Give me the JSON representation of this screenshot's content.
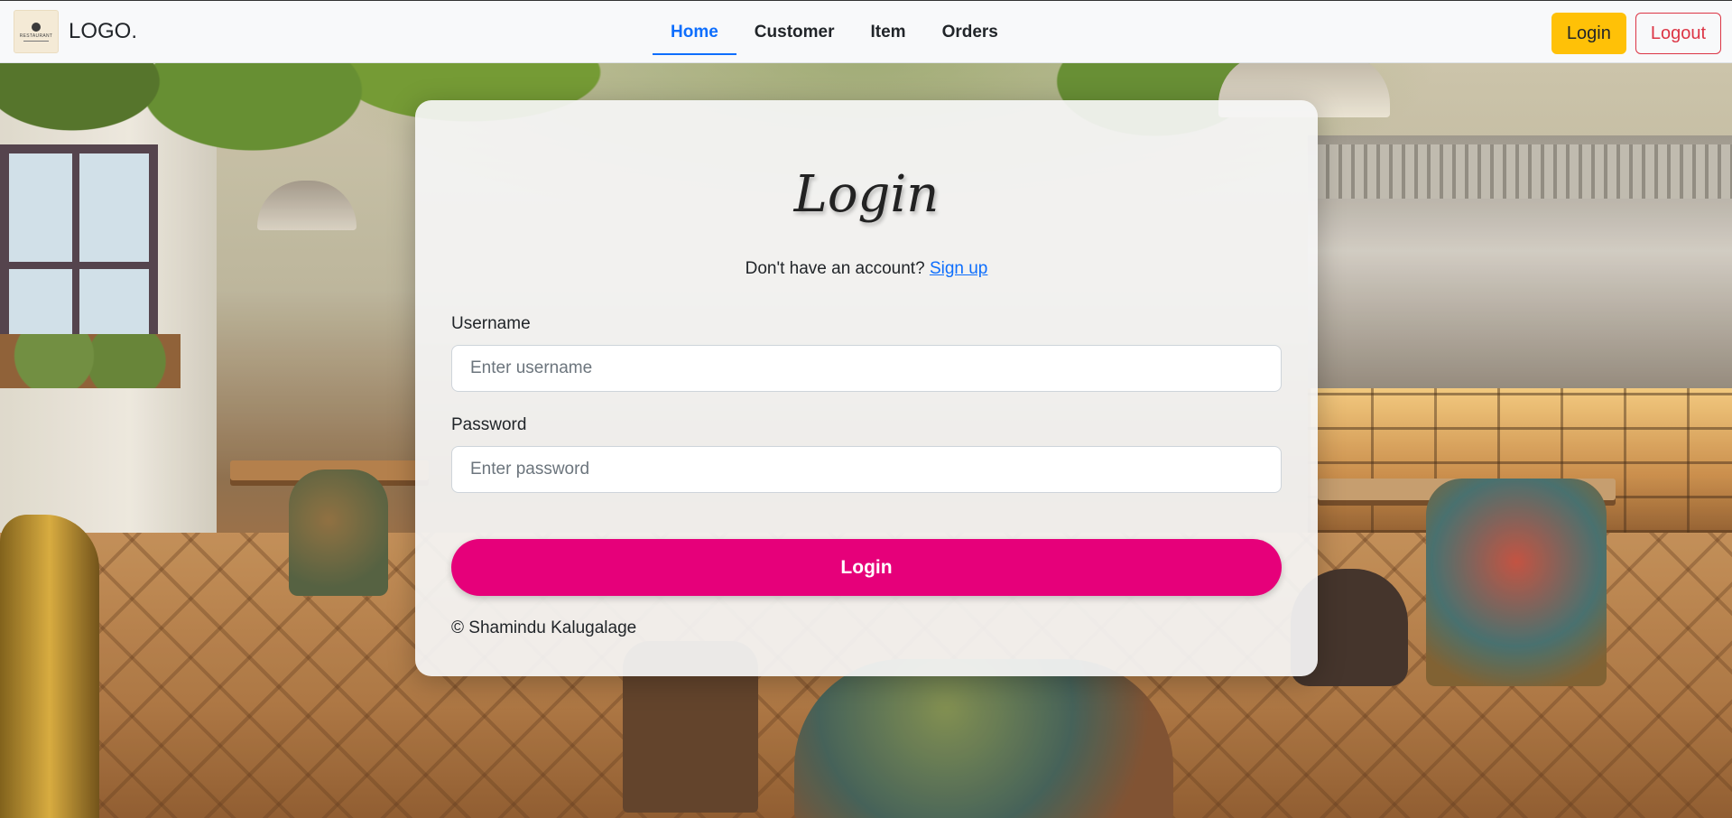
{
  "navbar": {
    "brand_logo_text": "RESTAURANT",
    "brand_name": "LOGO.",
    "links": [
      {
        "label": "Home",
        "active": true
      },
      {
        "label": "Customer",
        "active": false
      },
      {
        "label": "Item",
        "active": false
      },
      {
        "label": "Orders",
        "active": false
      }
    ],
    "login_label": "Login",
    "logout_label": "Logout"
  },
  "login_card": {
    "title": "Login",
    "signup_prompt": "Don't have an account?",
    "signup_link": "Sign up",
    "username_label": "Username",
    "username_placeholder": "Enter username",
    "username_value": "",
    "password_label": "Password",
    "password_placeholder": "Enter password",
    "password_value": "",
    "submit_label": "Login",
    "copyright": "© Shamindu Kalugalage"
  },
  "colors": {
    "active_link": "#0d6efd",
    "login_nav_button": "#ffc107",
    "logout_nav_button": "#dc3545",
    "submit_button": "#e6007a",
    "signup_link": "#0d6efd"
  },
  "icons": {
    "brand_logo": "restaurant-logo-icon"
  }
}
